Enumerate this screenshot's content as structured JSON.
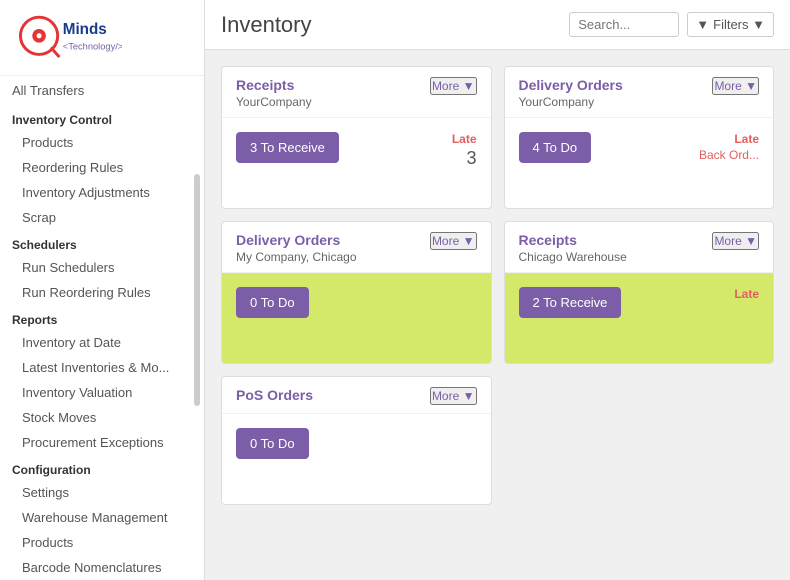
{
  "app": {
    "title": "Inventory",
    "search_placeholder": "Search..."
  },
  "header": {
    "filters_label": "Filters ▼"
  },
  "sidebar": {
    "top_items": [
      {
        "label": "All Transfers"
      }
    ],
    "sections": [
      {
        "label": "Inventory Control",
        "items": [
          "Products",
          "Reordering Rules",
          "Inventory Adjustments",
          "Scrap"
        ]
      },
      {
        "label": "Schedulers",
        "items": [
          "Run Schedulers",
          "Run Reordering Rules"
        ]
      },
      {
        "label": "Reports",
        "items": [
          "Inventory at Date",
          "Latest Inventories & Mo...",
          "Inventory Valuation",
          "Stock Moves",
          "Procurement Exceptions"
        ]
      },
      {
        "label": "Configuration",
        "items": [
          "Settings",
          "Warehouse Management",
          "Products",
          "Barcode Nomenclatures"
        ]
      }
    ]
  },
  "cards": [
    {
      "id": "card-receipts-yourcompany",
      "title": "Receipts",
      "subtitle": "YourCompany",
      "more_label": "More ▼",
      "button_label": "3 To Receive",
      "stat_late": "Late",
      "stat_number": "3",
      "body_bg": "normal"
    },
    {
      "id": "card-delivery-yourcompany",
      "title": "Delivery Orders",
      "subtitle": "YourCompany",
      "more_label": "More ▼",
      "button_label": "4 To Do",
      "stat_late": "Late",
      "stat_backord": "Back Ord...",
      "stat_number": "",
      "body_bg": "normal"
    },
    {
      "id": "card-delivery-chicago",
      "title": "Delivery Orders",
      "subtitle": "My Company, Chicago",
      "more_label": "More ▼",
      "button_label": "0 To Do",
      "stat_late": "",
      "stat_number": "",
      "body_bg": "green"
    },
    {
      "id": "card-receipts-chicago",
      "title": "Receipts",
      "subtitle": "Chicago Warehouse",
      "more_label": "More ▼",
      "button_label": "2 To Receive",
      "stat_late": "Late",
      "stat_number": "",
      "body_bg": "green"
    },
    {
      "id": "card-pos-orders",
      "title": "PoS Orders",
      "subtitle": "",
      "more_label": "More ▼",
      "button_label": "0 To Do",
      "stat_late": "",
      "stat_number": "",
      "body_bg": "normal"
    }
  ]
}
